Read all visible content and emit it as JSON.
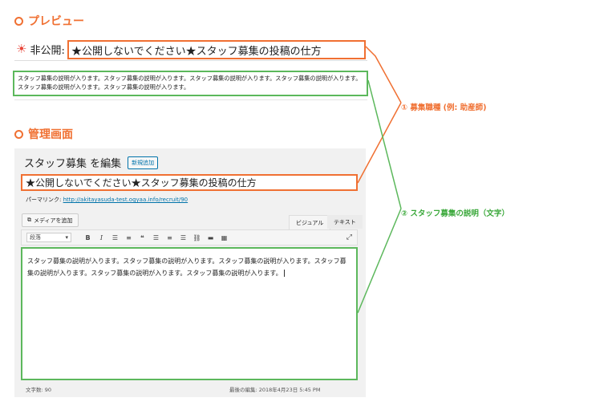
{
  "preview_section": {
    "heading": "プレビュー",
    "status_label": "非公開:",
    "post_title": "★公開しないでください★スタッフ募集の投稿の仕方",
    "description": "スタッフ募集の説明が入ります。スタッフ募集の説明が入ります。スタッフ募集の説明が入ります。スタッフ募集の説明が入ります。スタッフ募集の説明が入ります。スタッフ募集の説明が入ります。"
  },
  "admin_section": {
    "heading": "管理画面",
    "page_heading": "スタッフ募集 を編集",
    "add_new_label": "新規追加",
    "title_value": "★公開しないでください★スタッフ募集の投稿の仕方",
    "permalink_label": "パーマリンク:",
    "permalink_url": "http://akitayasuda-test.ogyaa.info/recruit/90",
    "add_media_label": "メディアを追加",
    "tabs": {
      "visual": "ビジュアル",
      "text": "テキスト"
    },
    "format_select": "段落",
    "editor_content": "スタッフ募集の説明が入ります。スタッフ募集の説明が入ります。スタッフ募集の説明が入ります。スタッフ募集の説明が入ります。スタッフ募集の説明が入ります。スタッフ募集の説明が入ります。",
    "word_count": "文字数: 90",
    "last_edited": "最後の編集: 2018年4月23日 5:45 PM"
  },
  "annotations": {
    "item1": "① 募集職種 (例: 助産師)",
    "item2": "② スタッフ募集の説明（文字）"
  },
  "colors": {
    "orange": "#f07032",
    "green": "#5cb85c",
    "link": "#0073aa"
  }
}
